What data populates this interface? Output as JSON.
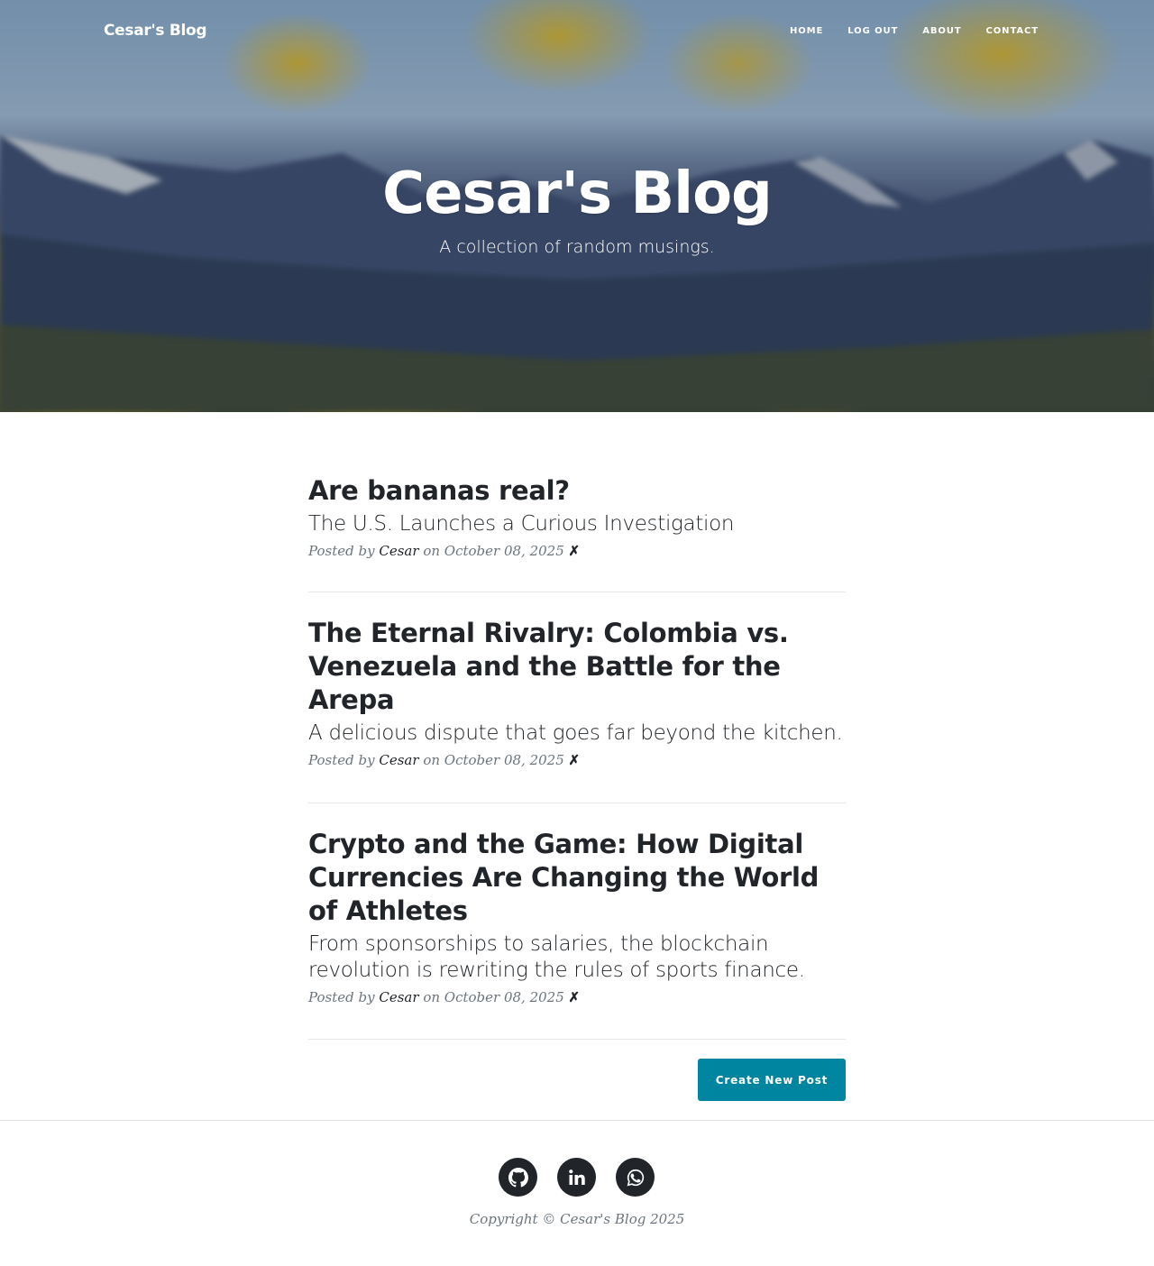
{
  "navbar": {
    "brand": "Cesar's Blog",
    "links": [
      "Home",
      "Log Out",
      "About",
      "Contact"
    ]
  },
  "hero": {
    "title": "Cesar's Blog",
    "subtitle": "A collection of random musings."
  },
  "posts": [
    {
      "title": "Are bananas real?",
      "subtitle": "The U.S. Launches a Curious Investigation",
      "posted_by": "Posted by",
      "author": "Cesar",
      "on": "on October 08, 2025",
      "delete": "✗"
    },
    {
      "title": "The Eternal Rivalry: Colombia vs. Venezuela and the Battle for the Arepa",
      "subtitle": "A delicious dispute that goes far beyond the kitchen.",
      "posted_by": "Posted by",
      "author": "Cesar",
      "on": "on October 08, 2025",
      "delete": "✗"
    },
    {
      "title": "Crypto and the Game: How Digital Currencies Are Changing the World of Athletes",
      "subtitle": "From sponsorships to salaries, the blockchain revolution is rewriting the rules of sports finance.",
      "posted_by": "Posted by",
      "author": "Cesar",
      "on": "on October 08, 2025",
      "delete": "✗"
    }
  ],
  "create_button": "Create New Post",
  "footer": {
    "socials": [
      "github-icon",
      "linkedin-icon",
      "whatsapp-icon"
    ],
    "copyright": "Copyright © Cesar's Blog 2025"
  },
  "colors": {
    "accent": "#0085a1",
    "text": "#212529",
    "muted": "#6c757d"
  }
}
